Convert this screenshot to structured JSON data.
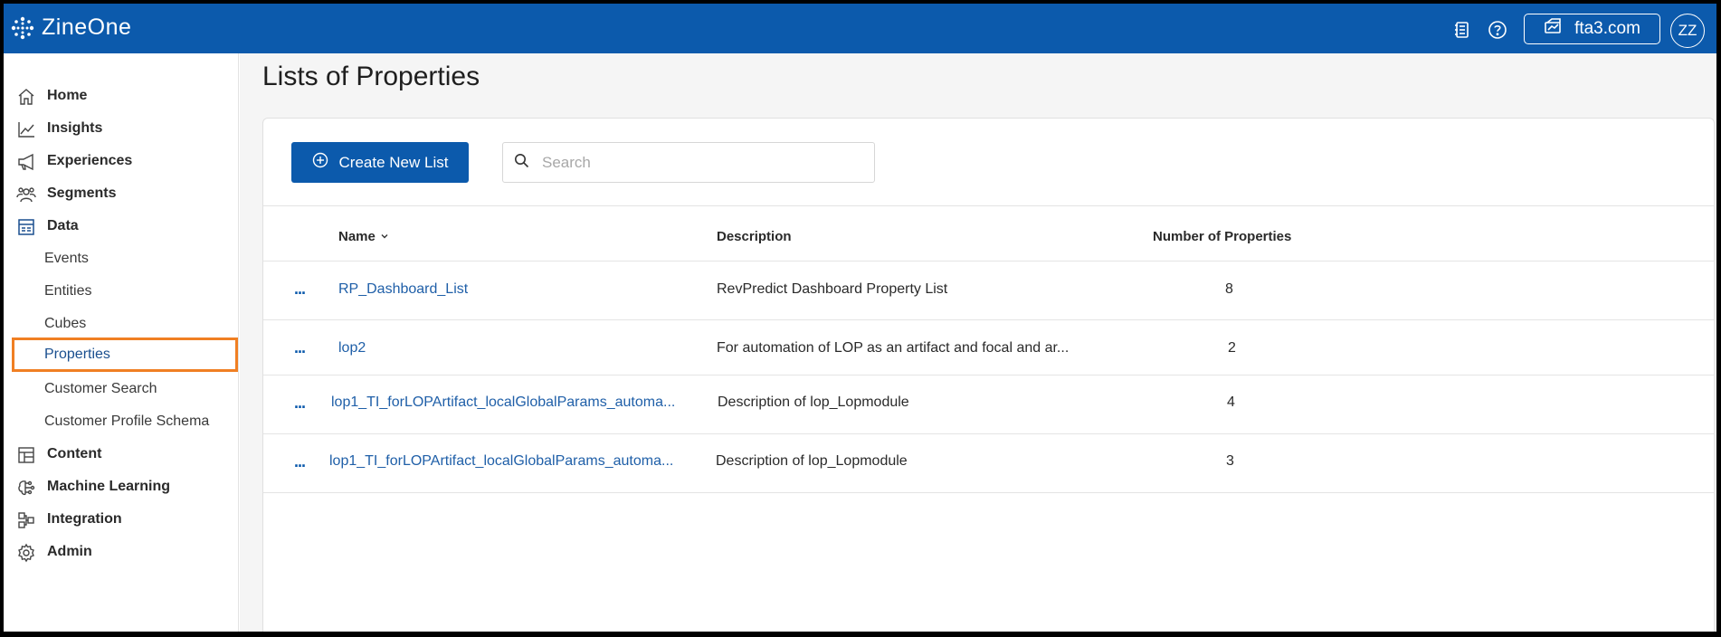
{
  "header": {
    "brand": "ZineOne",
    "tenant": "fta3.com",
    "avatar_initials": "ZZ",
    "icons": [
      "notebook-icon",
      "help-icon",
      "tenant-icon"
    ],
    "accent_color": "#0c5aac"
  },
  "sidebar": {
    "items": [
      {
        "label": "Home",
        "icon": "home-icon"
      },
      {
        "label": "Insights",
        "icon": "chart-line-icon"
      },
      {
        "label": "Experiences",
        "icon": "megaphone-icon"
      },
      {
        "label": "Segments",
        "icon": "users-icon"
      },
      {
        "label": "Data",
        "icon": "data-table-icon"
      },
      {
        "label": "Content",
        "icon": "layout-icon"
      },
      {
        "label": "Machine Learning",
        "icon": "brain-icon"
      },
      {
        "label": "Integration",
        "icon": "integration-icon"
      },
      {
        "label": "Admin",
        "icon": "gear-icon"
      }
    ],
    "data_subitems": [
      {
        "label": "Events"
      },
      {
        "label": "Entities"
      },
      {
        "label": "Cubes"
      },
      {
        "label": "Properties",
        "active": true
      },
      {
        "label": "Customer Search"
      },
      {
        "label": "Customer Profile Schema"
      }
    ],
    "highlight_color": "#f07f23"
  },
  "main": {
    "title": "Lists of Properties",
    "create_button": "Create New List",
    "search_placeholder": "Search",
    "columns": {
      "name": "Name",
      "description": "Description",
      "count": "Number of Properties"
    },
    "rows": [
      {
        "name": "RP_Dashboard_List",
        "description": "RevPredict Dashboard Property List",
        "count": "8"
      },
      {
        "name": "lop2",
        "description": "For automation of LOP as an artifact and focal and ar...",
        "count": "2"
      },
      {
        "name": "lop1_TI_forLOPArtifact_localGlobalParams_automa...",
        "description": "Description of lop_Lopmodule",
        "count": "4"
      },
      {
        "name": "lop1_TI_forLOPArtifact_localGlobalParams_automa...",
        "description": "Description of lop_Lopmodule",
        "count": "3"
      }
    ],
    "row_menu_glyph": "..."
  }
}
